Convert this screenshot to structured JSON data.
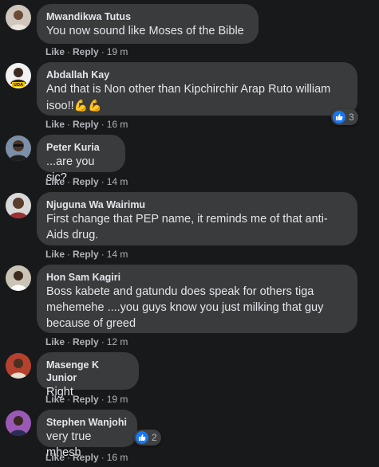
{
  "actions": {
    "like": "Like",
    "reply": "Reply",
    "separator": "·"
  },
  "colors": {
    "background": "#18191a",
    "bubble": "#3a3b3c",
    "like_blue": "#1877f2"
  },
  "comments": [
    {
      "author": "Mwandikwa Tutus",
      "text": "You now sound like Moses of the Bible",
      "time": "19 m"
    },
    {
      "author": "Abdallah Kay",
      "text": "And that is Non other than Kipchirchir Arap Ruto william isoo!!",
      "emoji": "💪💪",
      "time": "16 m",
      "reactions": "3",
      "avatar_badge": "UDA"
    },
    {
      "author": "Peter Kuria",
      "text": "...are you sic?",
      "time": "14 m"
    },
    {
      "author": "Njuguna Wa Wairimu",
      "text": "First change that PEP name, it reminds me of that anti-Aids drug.",
      "time": "14 m"
    },
    {
      "author": "Hon Sam Kagiri",
      "text": "Boss kabete and gatundu does speak for others tiga mehemehe ....you guys know you just milking that guy because of greed",
      "time": "12 m"
    },
    {
      "author": "Masenge K Junior",
      "text": "Right",
      "time": "19 m"
    },
    {
      "author": "Stephen Wanjohi",
      "text": "very true mhesh",
      "time": "16 m",
      "reactions": "2"
    }
  ]
}
